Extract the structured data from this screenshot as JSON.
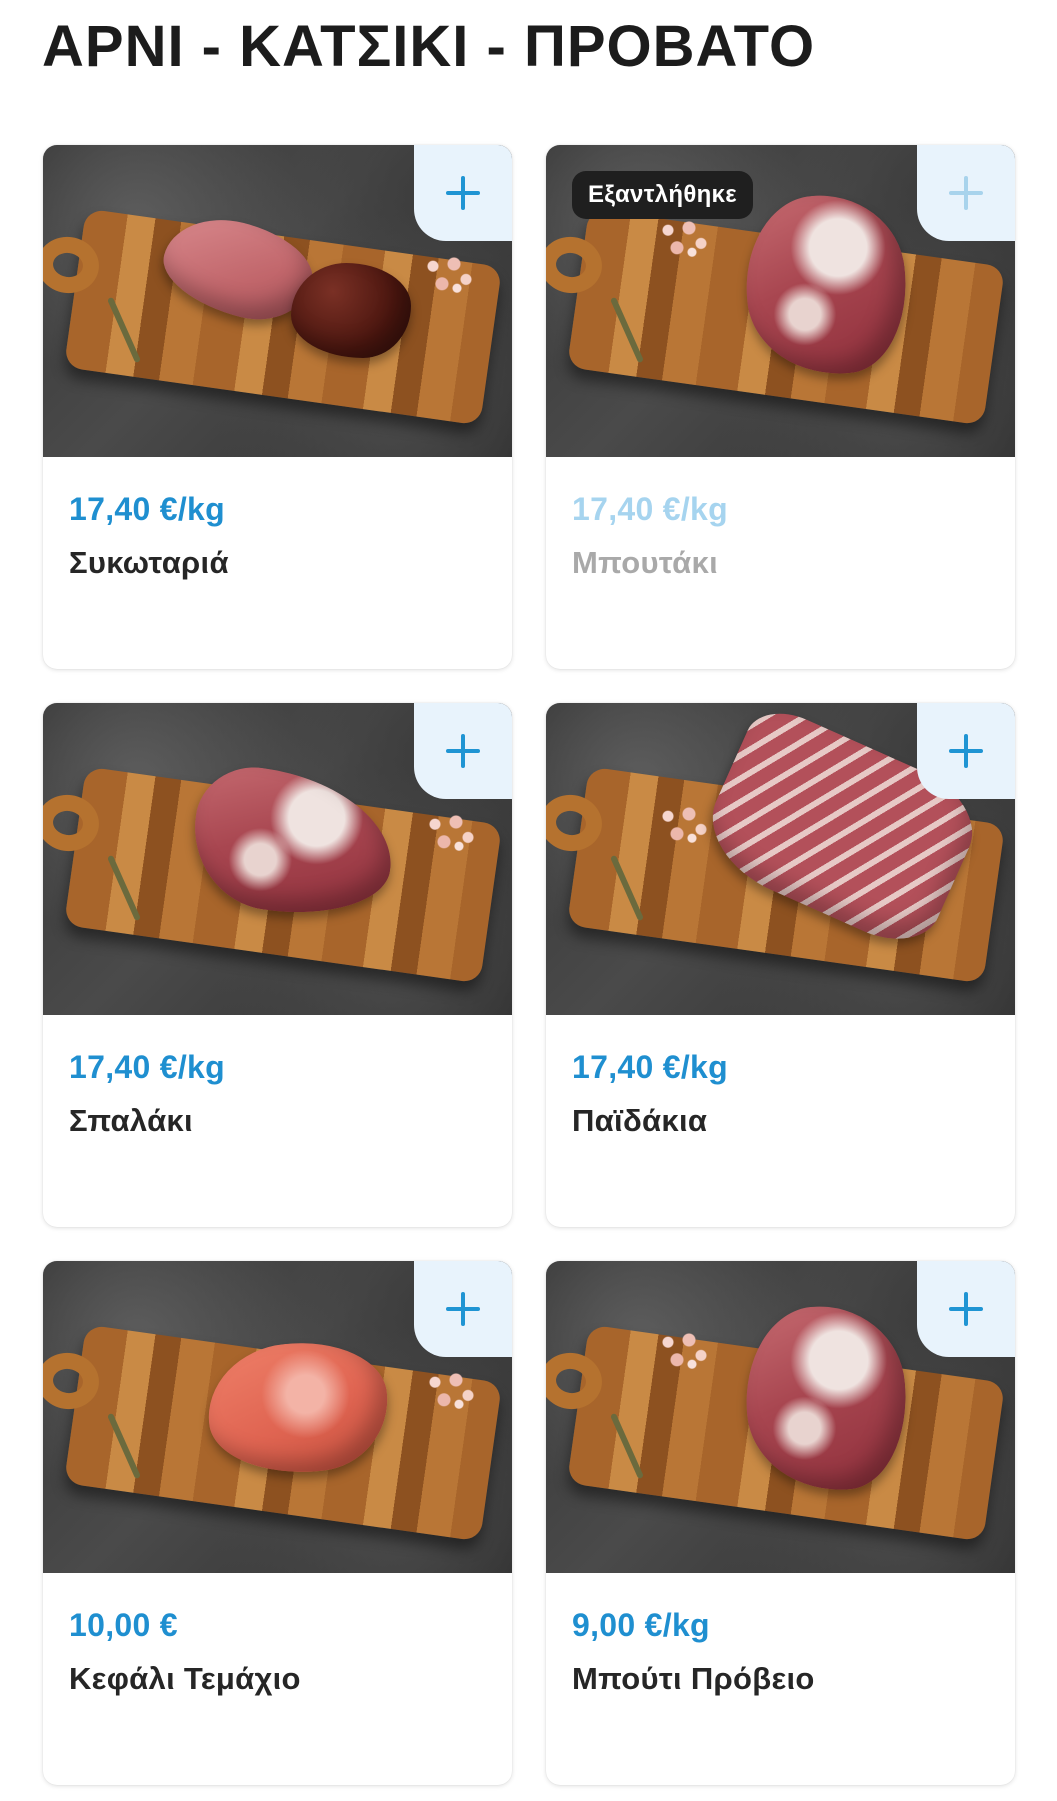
{
  "category": {
    "title": "ΑΡΝΙ - ΚΑΤΣΙΚΙ - ΠΡΟΒΑΤΟ"
  },
  "products": [
    {
      "price": "17,40 €/kg",
      "name": "Συκωταριά",
      "image": "lamb-pluck-on-board",
      "sold_out": false
    },
    {
      "price": "17,40 €/kg",
      "name": "Μπουτάκι",
      "image": "lamb-leg-on-board",
      "sold_out": true,
      "badge": "Εξαντλήθηκε"
    },
    {
      "price": "17,40 €/kg",
      "name": "Σπαλάκι",
      "image": "lamb-shoulder-on-board",
      "sold_out": false
    },
    {
      "price": "17,40 €/kg",
      "name": "Παϊδάκια",
      "image": "lamb-ribs-on-board",
      "sold_out": false
    },
    {
      "price": "10,00 €",
      "name": "Κεφάλι Τεμάχιο",
      "image": "lamb-head-on-board",
      "sold_out": false
    },
    {
      "price": "9,00 €/kg",
      "name": "Μπούτι Πρόβειο",
      "image": "mutton-leg-on-board",
      "sold_out": false
    }
  ],
  "add_button_icon": "plus-icon",
  "colors": {
    "accent": "#1f94d3",
    "price": "#1f8fd0",
    "add_button_bg": "#e8f3fc",
    "badge_bg": "#1f1f1f",
    "sold_out_text": "#a9a9a9"
  }
}
